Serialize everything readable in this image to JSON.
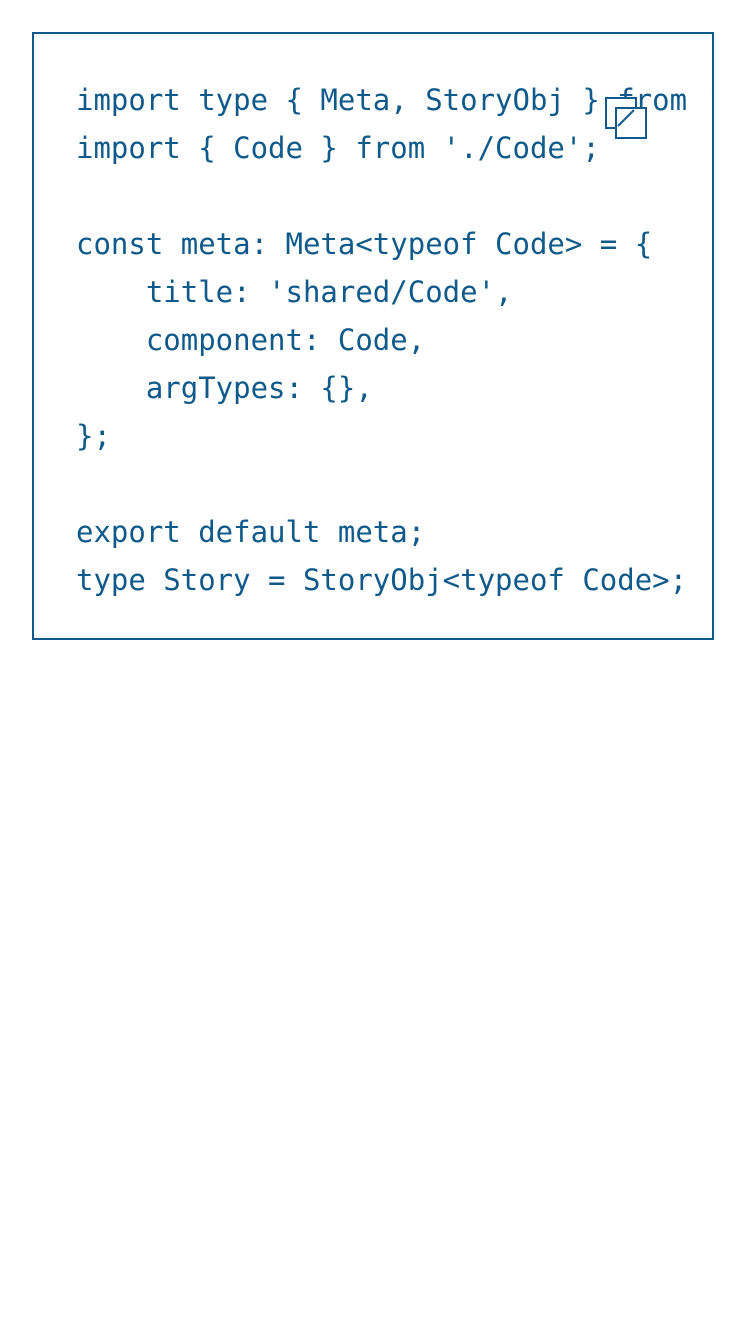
{
  "code": {
    "lines": [
      "import type { Meta, StoryObj } from '",
      "import { Code } from './Code';",
      "",
      "const meta: Meta<typeof Code> = {",
      "    title: 'shared/Code',",
      "    component: Code,",
      "    argTypes: {},",
      "};",
      "",
      "export default meta;",
      "type Story = StoryObj<typeof Code>;"
    ]
  },
  "copy_button": {
    "icon": "copy-icon"
  },
  "colors": {
    "accent": "#0f5a8a",
    "background": "#ffffff"
  }
}
